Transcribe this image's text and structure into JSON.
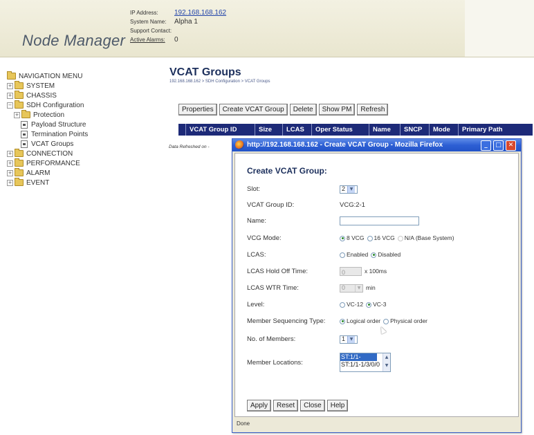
{
  "header": {
    "logo": "Node Manager",
    "ip_label": "IP Address:",
    "ip_value": "192.168.168.162",
    "system_label": "System Name:",
    "system_value": "Alpha 1",
    "support_label": "Support Contact:",
    "support_value": "",
    "alarms_label": "Active Alarms:",
    "alarms_value": "0"
  },
  "nav": {
    "items": [
      {
        "label": "NAVIGATION MENU"
      },
      {
        "label": "SYSTEM"
      },
      {
        "label": "CHASSIS"
      },
      {
        "label": "SDH Configuration"
      },
      {
        "label": "Protection"
      },
      {
        "label": "Payload Structure"
      },
      {
        "label": "Termination Points"
      },
      {
        "label": "VCAT Groups"
      },
      {
        "label": "CONNECTION"
      },
      {
        "label": "PERFORMANCE"
      },
      {
        "label": "ALARM"
      },
      {
        "label": "EVENT"
      }
    ]
  },
  "main": {
    "title": "VCAT Groups",
    "breadcrumb": "192.168.168.162 > SDH Configuration > VCAT Groups",
    "buttons": {
      "properties": "Properties",
      "create": "Create VCAT Group",
      "delete": "Delete",
      "show_pm": "Show PM",
      "refresh": "Refresh"
    },
    "columns": [
      "VCAT Group ID",
      "Size",
      "LCAS",
      "Oper Status",
      "Name",
      "SNCP",
      "Mode",
      "Primary Path"
    ],
    "refreshed": "Data Refreshed on -"
  },
  "popup": {
    "window_title": "http://192.168.168.162 - Create VCAT Group - Mozilla Firefox",
    "form_title": "Create VCAT Group:",
    "slot_label": "Slot:",
    "slot_value": "2",
    "group_id_label": "VCAT Group ID:",
    "group_id_value": "VCG:2-1",
    "name_label": "Name:",
    "name_value": "",
    "vcg_mode_label": "VCG Mode:",
    "vcg_mode_options": [
      "8 VCG",
      "16 VCG",
      "N/A (Base System)"
    ],
    "vcg_mode_selected": "8 VCG",
    "lcas_label": "LCAS:",
    "lcas_options": [
      "Enabled",
      "Disabled"
    ],
    "lcas_selected": "Disabled",
    "hold_off_label": "LCAS Hold Off Time:",
    "hold_off_value": "0",
    "hold_off_unit": "x 100ms",
    "wtr_label": "LCAS WTR Time:",
    "wtr_value": "0",
    "wtr_unit": "min",
    "level_label": "Level:",
    "level_options": [
      "VC-12",
      "VC-3"
    ],
    "level_selected": "VC-3",
    "seq_label": "Member Sequencing Type:",
    "seq_options": [
      "Logical order",
      "Physical order"
    ],
    "seq_selected": "Logical order",
    "members_label": "No. of Members:",
    "members_value": "1",
    "locations_label": "Member Locations:",
    "locations": [
      "ST:1/1-1/2/0/0",
      "ST:1/1-1/3/0/0"
    ],
    "buttons": {
      "apply": "Apply",
      "reset": "Reset",
      "close": "Close",
      "help": "Help"
    },
    "status": "Done"
  }
}
